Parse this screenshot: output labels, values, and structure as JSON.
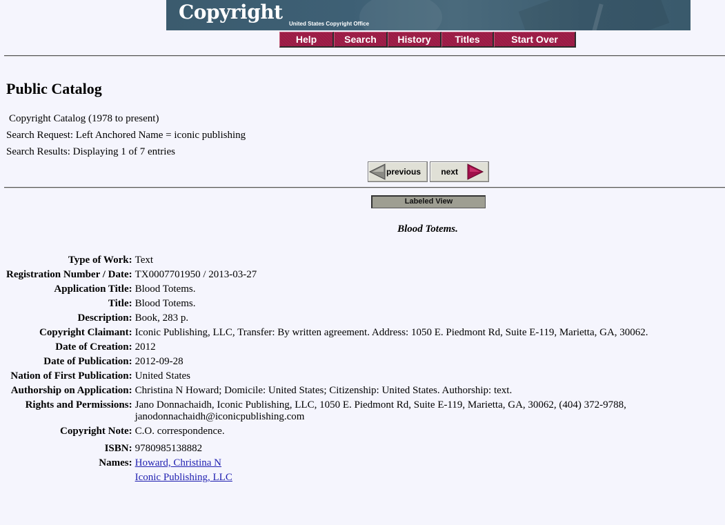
{
  "header": {
    "logo_text": "Copyright",
    "logo_subtitle": "United States Copyright Office",
    "nav": [
      {
        "label": "Help"
      },
      {
        "label": "Search"
      },
      {
        "label": "History"
      },
      {
        "label": "Titles"
      },
      {
        "label": "Start Over"
      }
    ],
    "colors": {
      "banner": "#3e6075",
      "nav_button": "#9b1b45"
    }
  },
  "page": {
    "title": "Public Catalog",
    "catalog": "Copyright Catalog (1978 to present)",
    "search_request": "Search Request: Left Anchored Name = iconic publishing",
    "search_results": "Search Results: Displaying 1 of 7 entries"
  },
  "pager": {
    "previous_label": "previous",
    "next_label": "next",
    "view_label": "Labeled View"
  },
  "record": {
    "heading": "Blood Totems.",
    "fields": [
      {
        "label": "Type of Work:",
        "value": "Text"
      },
      {
        "label": "Registration Number / Date:",
        "value": "TX0007701950 / 2013-03-27"
      },
      {
        "label": "Application Title:",
        "value": "Blood Totems."
      },
      {
        "label": "Title:",
        "value": "Blood Totems."
      },
      {
        "label": "Description:",
        "value": "Book, 283 p."
      },
      {
        "label": "Copyright Claimant:",
        "value": "Iconic Publishing, LLC, Transfer: By written agreement. Address: 1050 E. Piedmont Rd, Suite E-119, Marietta, GA, 30062."
      },
      {
        "label": "Date of Creation:",
        "value": "2012"
      },
      {
        "label": "Date of Publication:",
        "value": "2012-09-28"
      },
      {
        "label": "Nation of First Publication:",
        "value": "United States"
      },
      {
        "label": "Authorship on Application:",
        "value": "Christina N Howard; Domicile: United States; Citizenship: United States. Authorship: text."
      },
      {
        "label": "Rights and Permissions:",
        "value": "Jano Donnachaidh, Iconic Publishing, LLC, 1050 E. Piedmont Rd, Suite E-119, Marietta, GA, 30062, (404) 372-9788, janodonnachaidh@iconicpublishing.com"
      },
      {
        "label": "Copyright Note:",
        "value": "C.O. correspondence."
      },
      {
        "label": "ISBN:",
        "value": "9780985138882"
      }
    ],
    "names_label": "Names:",
    "names": [
      "Howard, Christina N",
      "Iconic Publishing, LLC"
    ]
  }
}
